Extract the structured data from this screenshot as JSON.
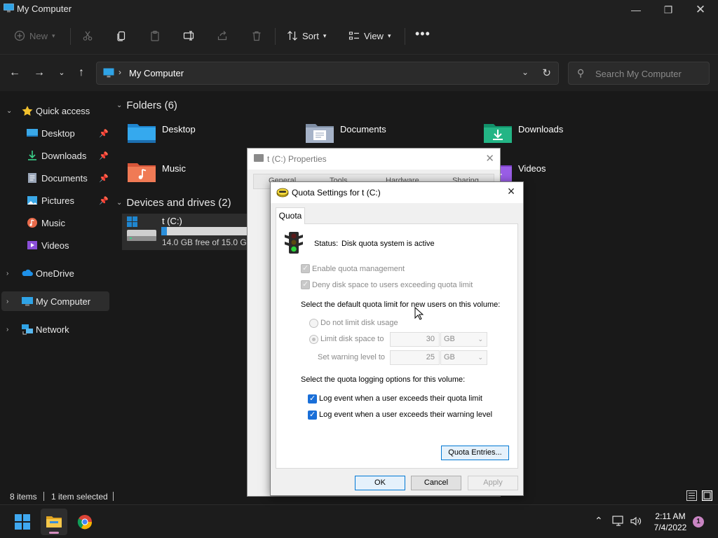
{
  "window": {
    "title": "My Computer"
  },
  "toolbar": {
    "new_label": "New",
    "sort_label": "Sort",
    "view_label": "View"
  },
  "address": {
    "path": "My Computer",
    "search_placeholder": "Search My Computer"
  },
  "sidebar": {
    "items": [
      {
        "label": "Quick access"
      },
      {
        "label": "Desktop"
      },
      {
        "label": "Downloads"
      },
      {
        "label": "Documents"
      },
      {
        "label": "Pictures"
      },
      {
        "label": "Music"
      },
      {
        "label": "Videos"
      },
      {
        "label": "OneDrive"
      },
      {
        "label": "My Computer"
      },
      {
        "label": "Network"
      }
    ]
  },
  "content": {
    "folders_header": "Folders (6)",
    "folders": [
      {
        "name": "Desktop"
      },
      {
        "name": "Documents"
      },
      {
        "name": "Downloads"
      },
      {
        "name": "Music"
      },
      {
        "name": "Videos"
      }
    ],
    "drives_header": "Devices and drives (2)",
    "drive": {
      "name": "t (C:)",
      "free_text": "14.0 GB free of 15.0 GB",
      "used_fraction": 0.0667
    }
  },
  "status": {
    "items": "8 items",
    "selected": "1 item selected"
  },
  "properties_dialog": {
    "title": "t (C:) Properties",
    "tabs": [
      "General",
      "Tools",
      "Hardware",
      "Sharing"
    ]
  },
  "quota_dialog": {
    "title": "Quota Settings for t (C:)",
    "tab": "Quota",
    "status_label": "Status:",
    "status_value": "Disk quota system is active",
    "enable_label": "Enable quota management",
    "deny_label": "Deny disk space to users exceeding quota limit",
    "default_limit_text": "Select the default quota limit for new users on this volume:",
    "no_limit_label": "Do not limit disk usage",
    "limit_label": "Limit disk space to",
    "limit_value": "30",
    "limit_unit": "GB",
    "warning_label": "Set warning level to",
    "warning_value": "25",
    "warning_unit": "GB",
    "logging_text": "Select the quota logging options for this volume:",
    "log_limit_label": "Log event when a user exceeds their quota limit",
    "log_warning_label": "Log event when a user exceeds their warning level",
    "entries_button": "Quota Entries...",
    "ok_button": "OK",
    "cancel_button": "Cancel",
    "apply_button": "Apply"
  },
  "taskbar": {
    "time": "2:11 AM",
    "date": "7/4/2022",
    "notifications": "1"
  },
  "colors": {
    "accent": "#1a6fd8",
    "drive_bar": "#2b8fdb",
    "badge": "#c985c3"
  }
}
